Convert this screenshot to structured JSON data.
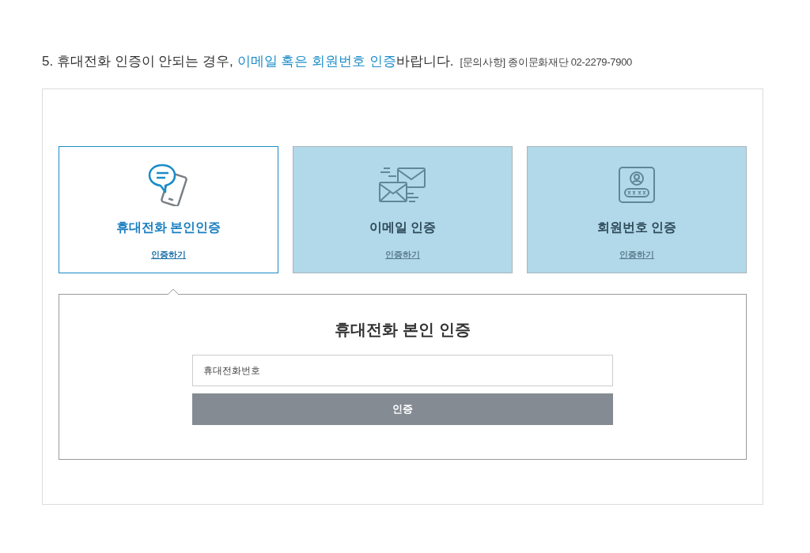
{
  "notice": {
    "text_before": "5. 휴대전화 인증이 안되는 경우,",
    "highlight": "이메일 혹은 회원번호 인증",
    "text_after": "바랍니다.",
    "contact": "[문의사항] 종이문화재단 02-2279-7900"
  },
  "methods": [
    {
      "kind": "phone",
      "title": "휴대전화 본인인증",
      "link": "인증하기",
      "selected": true
    },
    {
      "kind": "email",
      "title": "이메일 인증",
      "link": "인증하기",
      "selected": false
    },
    {
      "kind": "member",
      "title": "회원번호 인증",
      "link": "인증하기",
      "selected": false
    }
  ],
  "form": {
    "title": "휴대전화 본인 인증",
    "input": {
      "placeholder": "휴대전화번호"
    },
    "button": "인증"
  }
}
